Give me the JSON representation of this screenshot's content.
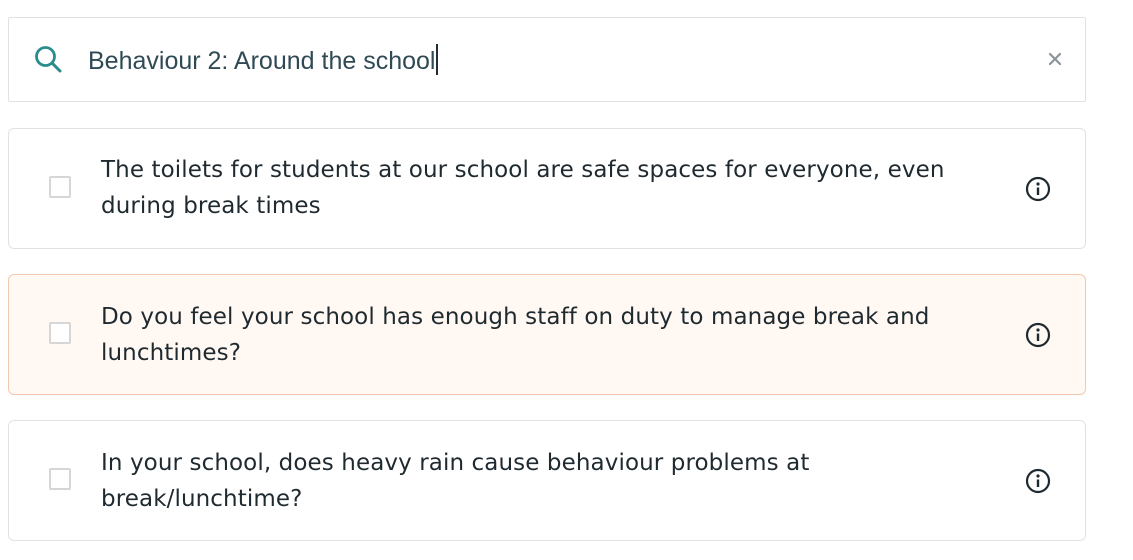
{
  "search": {
    "value": "Behaviour 2: Around the school",
    "clear_label": "×"
  },
  "questions": [
    {
      "label": "The toilets for students at our school are safe spaces for everyone, even during break times",
      "highlighted": false,
      "checked": false
    },
    {
      "label": "Do you feel your school has enough staff on duty to manage break and lunchtimes?",
      "highlighted": true,
      "checked": false
    },
    {
      "label": "In your school, does heavy rain cause behaviour problems at break/lunchtime?",
      "highlighted": false,
      "checked": false
    }
  ],
  "colors": {
    "accent": "#2a8c8c",
    "highlight_bg": "#fff8f3",
    "highlight_border": "#f2c9ae"
  },
  "icons": {
    "search": "search-icon",
    "clear": "close-icon",
    "info": "info-icon"
  }
}
